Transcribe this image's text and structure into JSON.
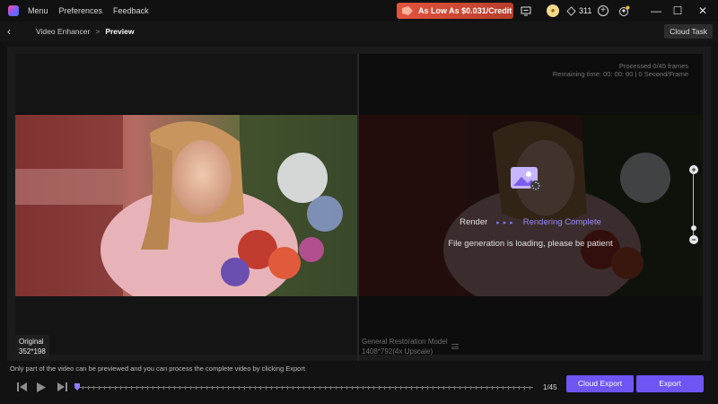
{
  "topbar": {
    "menu": [
      "Menu",
      "Preferences",
      "Feedback"
    ],
    "promo": "As Low As $0.031/Credit",
    "credits": "311",
    "window_controls": {
      "minimize": "—",
      "maximize": "☐",
      "close": "✕"
    }
  },
  "breadcrumb": {
    "back": "‹",
    "parent": "Video Enhancer",
    "separator": ">",
    "current": "Preview"
  },
  "cloud_task": "Cloud Task",
  "original": {
    "label": "Original",
    "resolution": "352*198"
  },
  "output": {
    "model": "General Restoration Model",
    "resolution": "1408*792(4x Upscale)",
    "processed": "Processed 0/45 frames",
    "remaining": "Remaining time: 00: 00: 00 | 0 Second/Frame"
  },
  "render": {
    "label": "Render",
    "arrows": "▸ ▸ ▸",
    "status": "Rendering Complete",
    "message": "File generation is loading, please be patient"
  },
  "zoom": {
    "plus": "+",
    "minus": "−"
  },
  "hint": "Only part of the video can be previewed and you can process the complete video by clicking Export",
  "player": {
    "frame_counter": "1/45",
    "cloud_export": "Cloud Export",
    "export": "Export"
  },
  "colors": {
    "accent": "#6f55f3",
    "promo": "#e4533d"
  },
  "icons": [
    "app-logo-icon",
    "tag-icon",
    "screen-icon",
    "coin-icon",
    "diamond-icon",
    "plus-circle-icon",
    "avatar-crown-icon",
    "image-icon",
    "loading-icon",
    "prev-frame-icon",
    "play-icon",
    "next-frame-icon"
  ]
}
